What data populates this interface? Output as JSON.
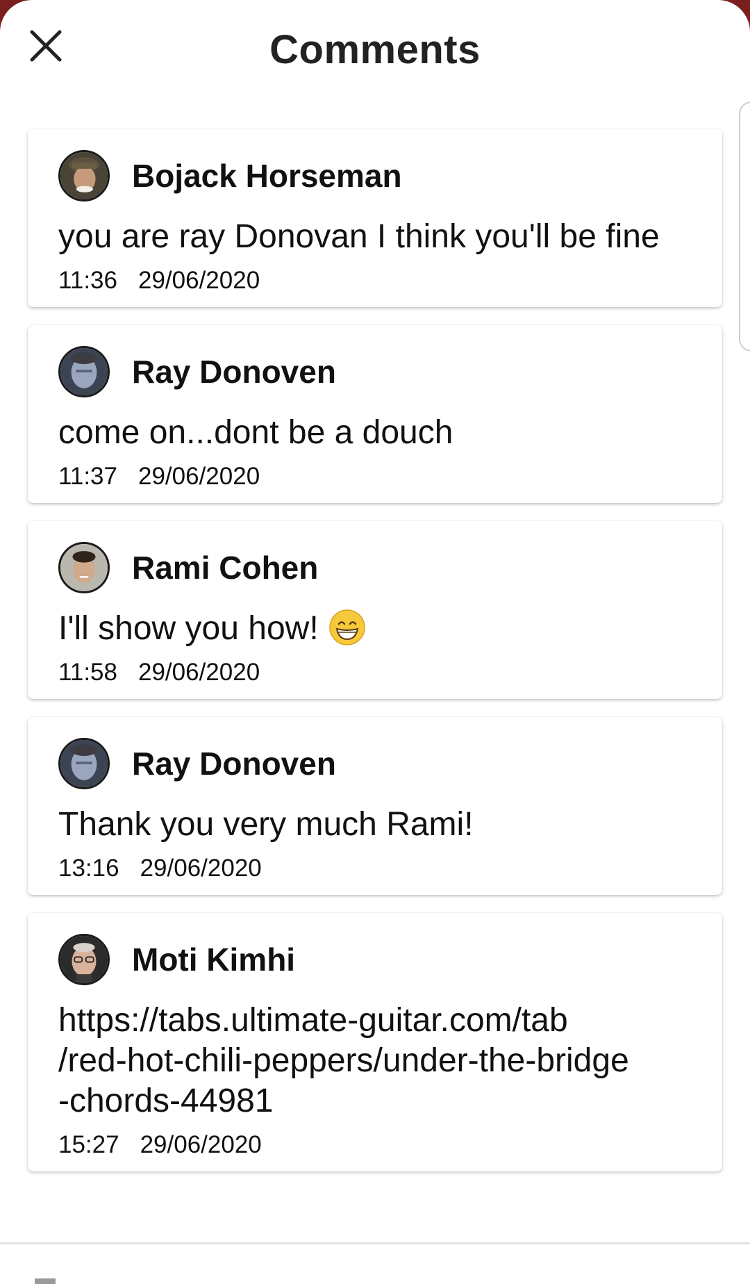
{
  "header": {
    "title": "Comments"
  },
  "comments": [
    {
      "author": "Bojack Horseman",
      "text": "you are ray Donovan I think you'll be fine",
      "time": "11:36",
      "date": "29/06/2020"
    },
    {
      "author": "Ray Donoven",
      "text": "come on...dont be a douch",
      "time": "11:37",
      "date": "29/06/2020"
    },
    {
      "author": "Rami Cohen",
      "text": "I'll show you how!",
      "emoji": "grinning-face-with-smiling-eyes",
      "time": "11:58",
      "date": "29/06/2020"
    },
    {
      "author": "Ray Donoven",
      "text": "Thank you very much Rami!",
      "time": "13:16",
      "date": "29/06/2020"
    },
    {
      "author": "Moti Kimhi",
      "text": "https://tabs.ultimate-guitar.com/tab\n/red-hot-chili-peppers/under-the-bridge\n-chords-44981",
      "time": "15:27",
      "date": "29/06/2020"
    }
  ],
  "colors": {
    "background_behind_sheet": "#7a1e1e",
    "sheet": "#ffffff",
    "text": "#111111"
  }
}
